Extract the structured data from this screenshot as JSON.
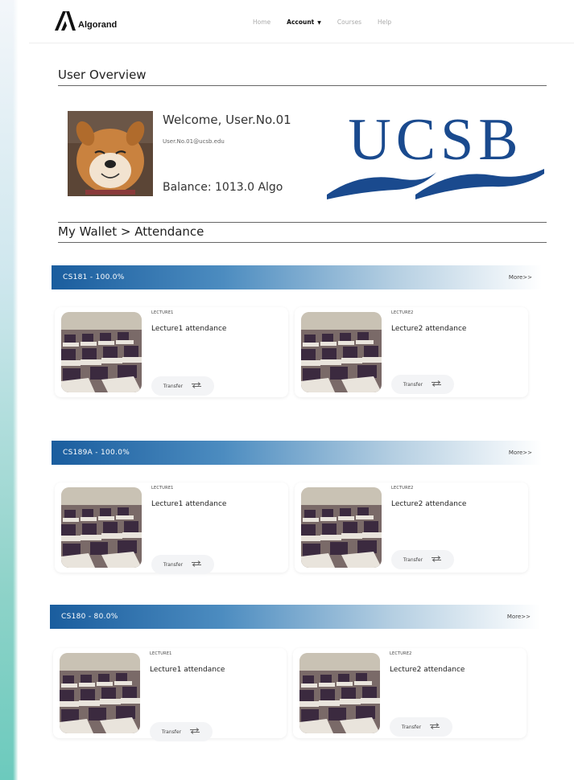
{
  "navbar": {
    "logo_text": "Algorand",
    "links": [
      "Home",
      "Account",
      "Courses",
      "Help"
    ],
    "active_link": "Account"
  },
  "overview": {
    "title": "User Overview",
    "welcome": "Welcome, User.No.01",
    "email": "User.No.01@ucsb.edu",
    "balance": "Balance: 1013.0 Algo",
    "logo_text": "UCSB"
  },
  "wallet": {
    "title": "My Wallet > Attendance"
  },
  "courses": [
    {
      "label": "CS181  -  100.0%",
      "more": "More>>",
      "cards": [
        {
          "tag": "LECTURE1",
          "title": "Lecture1 attendance",
          "button": "Transfer"
        },
        {
          "tag": "LECTURE2",
          "title": "Lecture2 attendance",
          "button": "Transfer"
        }
      ]
    },
    {
      "label": "CS189A  -  100.0%",
      "more": "More>>",
      "cards": [
        {
          "tag": "LECTURE1",
          "title": "Lecture1 attendance",
          "button": "Transfer"
        },
        {
          "tag": "LECTURE2",
          "title": "Lecture2 attendance",
          "button": "Transfer"
        }
      ]
    },
    {
      "label": "CS180  -  80.0%",
      "more": "More>>",
      "cards": [
        {
          "tag": "LECTURE1",
          "title": "Lecture1 attendance",
          "button": "Transfer"
        },
        {
          "tag": "LECTURE2",
          "title": "Lecture2 attendance",
          "button": "Transfer"
        }
      ]
    }
  ],
  "colors": {
    "banner_start": "#1a5d9e",
    "ucsb_blue": "#1a4a8e"
  },
  "icons": {
    "logo": "algorand-logo-icon",
    "transfer": "transfer-arrows-icon"
  }
}
